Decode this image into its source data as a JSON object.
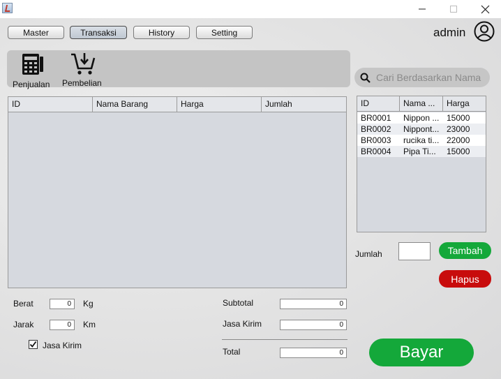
{
  "nav": {
    "master": "Master",
    "transaksi": "Transaksi",
    "history": "History",
    "setting": "Setting"
  },
  "user": {
    "name": "admin"
  },
  "toolbar": {
    "penjualan": "Penjualan",
    "pembelian": "Pembelian"
  },
  "search": {
    "placeholder": "Cari Berdasarkan Nama"
  },
  "cart_table": {
    "headers": [
      "ID",
      "Nama Barang",
      "Harga",
      "Jumlah"
    ]
  },
  "product_table": {
    "headers": [
      "ID",
      "Nama ...",
      "Harga"
    ],
    "rows": [
      {
        "id": "BR0001",
        "nama": "Nippon ...",
        "harga": "15000"
      },
      {
        "id": "BR0002",
        "nama": "Nippont...",
        "harga": "23000"
      },
      {
        "id": "BR0003",
        "nama": "rucika ti...",
        "harga": "22000"
      },
      {
        "id": "BR0004",
        "nama": "Pipa Ti...",
        "harga": "15000"
      }
    ]
  },
  "form": {
    "berat_label": "Berat",
    "berat_value": "0",
    "berat_unit": "Kg",
    "jarak_label": "Jarak",
    "jarak_value": "0",
    "jarak_unit": "Km",
    "jasa_kirim_checkbox": "Jasa Kirim",
    "jasa_kirim_checked": true,
    "subtotal_label": "Subtotal",
    "subtotal_value": "0",
    "jasa_kirim_label": "Jasa Kirim",
    "jasa_kirim_value": "0",
    "total_label": "Total",
    "total_value": "0",
    "jumlah_label": "Jumlah",
    "jumlah_value": ""
  },
  "actions": {
    "tambah": "Tambah",
    "hapus": "Hapus",
    "bayar": "Bayar"
  },
  "colors": {
    "green": "#14a83a",
    "red": "#c80c0c"
  }
}
